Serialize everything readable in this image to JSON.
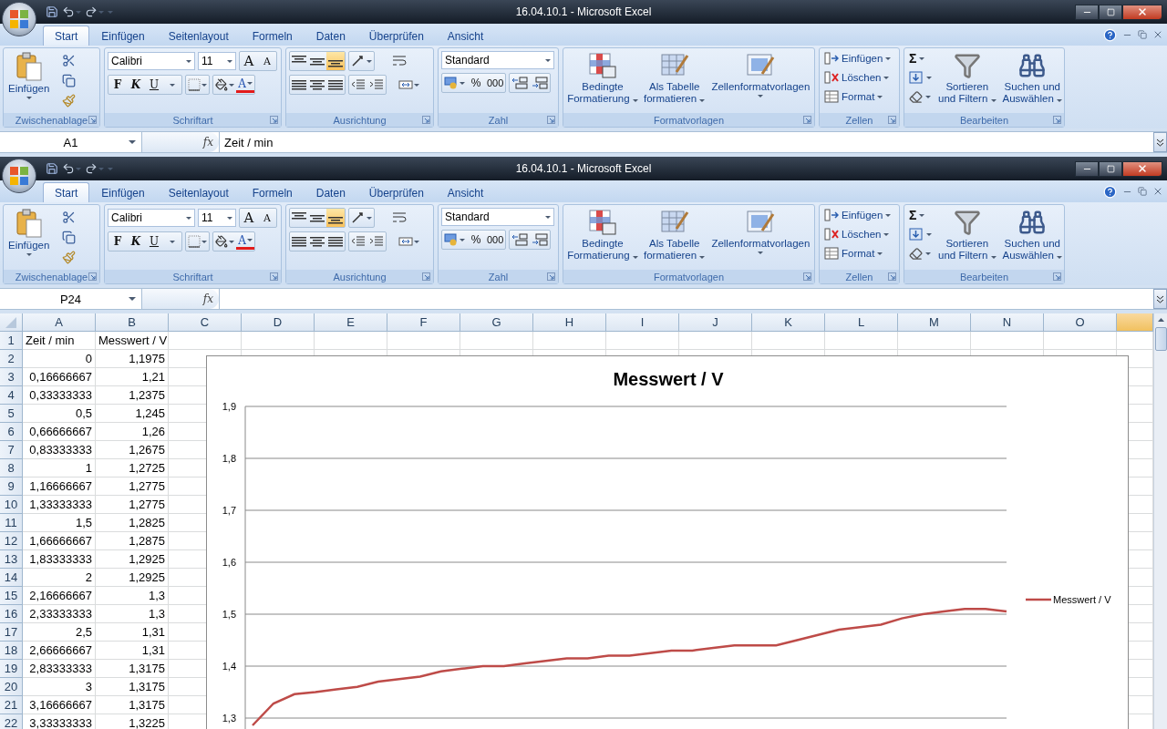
{
  "windows": [
    {
      "title": "16.04.10.1  -  Microsoft Excel",
      "tabs": [
        {
          "label": "Start",
          "selected": true
        },
        {
          "label": "Einfügen",
          "selected": false
        },
        {
          "label": "Seitenlayout",
          "selected": false
        },
        {
          "label": "Formeln",
          "selected": false
        },
        {
          "label": "Daten",
          "selected": false
        },
        {
          "label": "Überprüfen",
          "selected": false
        },
        {
          "label": "Ansicht",
          "selected": false
        }
      ],
      "ribbon": {
        "clipboard": {
          "label": "Zwischenablage",
          "paste": "Einfügen"
        },
        "font": {
          "label": "Schriftart",
          "font": "Calibri",
          "size": "11",
          "grow": "A",
          "shrink": "A",
          "bold": "F",
          "italic": "K",
          "underline": "U",
          "font_color_letter": "A"
        },
        "alignment": {
          "label": "Ausrichtung",
          "vertical_align": [
            {
              "selected": false
            },
            {
              "selected": false
            },
            {
              "selected": true
            }
          ]
        },
        "number": {
          "label": "Zahl",
          "format": "Standard",
          "percent": "%",
          "thousands": "000"
        },
        "styles": {
          "label": "Formatvorlagen",
          "buttons": [
            {
              "kind": "conditional",
              "lines": [
                "Bedingte",
                "Formatierung"
              ]
            },
            {
              "kind": "table",
              "lines": [
                "Als Tabelle",
                "formatieren"
              ]
            },
            {
              "kind": "cellstyles",
              "lines": [
                "Zellenformatvorlagen"
              ]
            }
          ]
        },
        "cells": {
          "label": "Zellen",
          "buttons": [
            {
              "kind": "insert",
              "label": "Einfügen"
            },
            {
              "kind": "delete",
              "label": "Löschen"
            },
            {
              "kind": "format",
              "label": "Format"
            }
          ]
        },
        "editing": {
          "label": "Bearbeiten",
          "sum": "Σ",
          "buttons": [
            {
              "kind": "sort",
              "lines": [
                "Sortieren",
                "und Filtern"
              ]
            },
            {
              "kind": "find",
              "lines": [
                "Suchen und",
                "Auswählen"
              ]
            }
          ]
        }
      },
      "name_box": "A1",
      "fx": "fx",
      "formula": "Zeit / min"
    },
    {
      "title": "16.04.10.1  -  Microsoft Excel",
      "tabs": [
        {
          "label": "Start",
          "selected": true
        },
        {
          "label": "Einfügen",
          "selected": false
        },
        {
          "label": "Seitenlayout",
          "selected": false
        },
        {
          "label": "Formeln",
          "selected": false
        },
        {
          "label": "Daten",
          "selected": false
        },
        {
          "label": "Überprüfen",
          "selected": false
        },
        {
          "label": "Ansicht",
          "selected": false
        }
      ],
      "ribbon": {
        "clipboard": {
          "label": "Zwischenablage",
          "paste": "Einfügen"
        },
        "font": {
          "label": "Schriftart",
          "font": "Calibri",
          "size": "11",
          "grow": "A",
          "shrink": "A",
          "bold": "F",
          "italic": "K",
          "underline": "U",
          "font_color_letter": "A"
        },
        "alignment": {
          "label": "Ausrichtung",
          "vertical_align": [
            {
              "selected": false
            },
            {
              "selected": false
            },
            {
              "selected": true
            }
          ]
        },
        "number": {
          "label": "Zahl",
          "format": "Standard",
          "percent": "%",
          "thousands": "000"
        },
        "styles": {
          "label": "Formatvorlagen",
          "buttons": [
            {
              "kind": "conditional",
              "lines": [
                "Bedingte",
                "Formatierung"
              ]
            },
            {
              "kind": "table",
              "lines": [
                "Als Tabelle",
                "formatieren"
              ]
            },
            {
              "kind": "cellstyles",
              "lines": [
                "Zellenformatvorlagen"
              ]
            }
          ]
        },
        "cells": {
          "label": "Zellen",
          "buttons": [
            {
              "kind": "insert",
              "label": "Einfügen"
            },
            {
              "kind": "delete",
              "label": "Löschen"
            },
            {
              "kind": "format",
              "label": "Format"
            }
          ]
        },
        "editing": {
          "label": "Bearbeiten",
          "sum": "Σ",
          "buttons": [
            {
              "kind": "sort",
              "lines": [
                "Sortieren",
                "und Filtern"
              ]
            },
            {
              "kind": "find",
              "lines": [
                "Suchen und",
                "Auswählen"
              ]
            }
          ]
        }
      },
      "name_box": "P24",
      "fx": "fx"
    }
  ],
  "sheet": {
    "columns": [
      "A",
      "B",
      "C",
      "D",
      "E",
      "F",
      "G",
      "H",
      "I",
      "J",
      "K",
      "L",
      "M",
      "N",
      "O"
    ],
    "rows": [
      {
        "n": "1",
        "kind": "text",
        "cells": [
          "Zeit / min",
          "Messwert / V"
        ]
      },
      {
        "n": "2",
        "kind": "number",
        "cells": [
          "0",
          "1,1975"
        ]
      },
      {
        "n": "3",
        "kind": "number",
        "cells": [
          "0,16666667",
          "1,21"
        ]
      },
      {
        "n": "4",
        "kind": "number",
        "cells": [
          "0,33333333",
          "1,2375"
        ]
      },
      {
        "n": "5",
        "kind": "number",
        "cells": [
          "0,5",
          "1,245"
        ]
      },
      {
        "n": "6",
        "kind": "number",
        "cells": [
          "0,66666667",
          "1,26"
        ]
      },
      {
        "n": "7",
        "kind": "number",
        "cells": [
          "0,83333333",
          "1,2675"
        ]
      },
      {
        "n": "8",
        "kind": "number",
        "cells": [
          "1",
          "1,2725"
        ]
      },
      {
        "n": "9",
        "kind": "number",
        "cells": [
          "1,16666667",
          "1,2775"
        ]
      },
      {
        "n": "10",
        "kind": "number",
        "cells": [
          "1,33333333",
          "1,2775"
        ]
      },
      {
        "n": "11",
        "kind": "number",
        "cells": [
          "1,5",
          "1,2825"
        ]
      },
      {
        "n": "12",
        "kind": "number",
        "cells": [
          "1,66666667",
          "1,2875"
        ]
      },
      {
        "n": "13",
        "kind": "number",
        "cells": [
          "1,83333333",
          "1,2925"
        ]
      },
      {
        "n": "14",
        "kind": "number",
        "cells": [
          "2",
          "1,2925"
        ]
      },
      {
        "n": "15",
        "kind": "number",
        "cells": [
          "2,16666667",
          "1,3"
        ]
      },
      {
        "n": "16",
        "kind": "number",
        "cells": [
          "2,33333333",
          "1,3"
        ]
      },
      {
        "n": "17",
        "kind": "number",
        "cells": [
          "2,5",
          "1,31"
        ]
      },
      {
        "n": "18",
        "kind": "number",
        "cells": [
          "2,66666667",
          "1,31"
        ]
      },
      {
        "n": "19",
        "kind": "number",
        "cells": [
          "2,83333333",
          "1,3175"
        ]
      },
      {
        "n": "20",
        "kind": "number",
        "cells": [
          "3",
          "1,3175"
        ]
      },
      {
        "n": "21",
        "kind": "number",
        "cells": [
          "3,16666667",
          "1,3175"
        ]
      },
      {
        "n": "22",
        "kind": "number",
        "cells": [
          "3,33333333",
          "1,3225"
        ]
      }
    ],
    "chart_data": {
      "type": "line",
      "title": "Messwert / V",
      "grid": true,
      "ylim": [
        1.2,
        1.9
      ],
      "yticks": [
        {
          "value": 1.3,
          "label": "1,3"
        },
        {
          "value": 1.4,
          "label": "1,4"
        },
        {
          "value": 1.5,
          "label": "1,5"
        },
        {
          "value": 1.6,
          "label": "1,6"
        },
        {
          "value": 1.7,
          "label": "1,7"
        },
        {
          "value": 1.8,
          "label": "1,8"
        },
        {
          "value": 1.9,
          "label": "1,9"
        }
      ],
      "series": [
        {
          "name": "Messwert / V",
          "color": "#be4b48",
          "values": [
            1.286,
            1.328,
            1.346,
            1.35,
            1.355,
            1.36,
            1.37,
            1.375,
            1.38,
            1.39,
            1.395,
            1.4,
            1.4,
            1.405,
            1.41,
            1.415,
            1.415,
            1.42,
            1.42,
            1.425,
            1.43,
            1.43,
            1.435,
            1.44,
            1.44,
            1.44,
            1.45,
            1.46,
            1.47,
            1.475,
            1.48,
            1.492,
            1.5,
            1.505,
            1.51,
            1.51,
            1.505
          ]
        }
      ]
    }
  }
}
